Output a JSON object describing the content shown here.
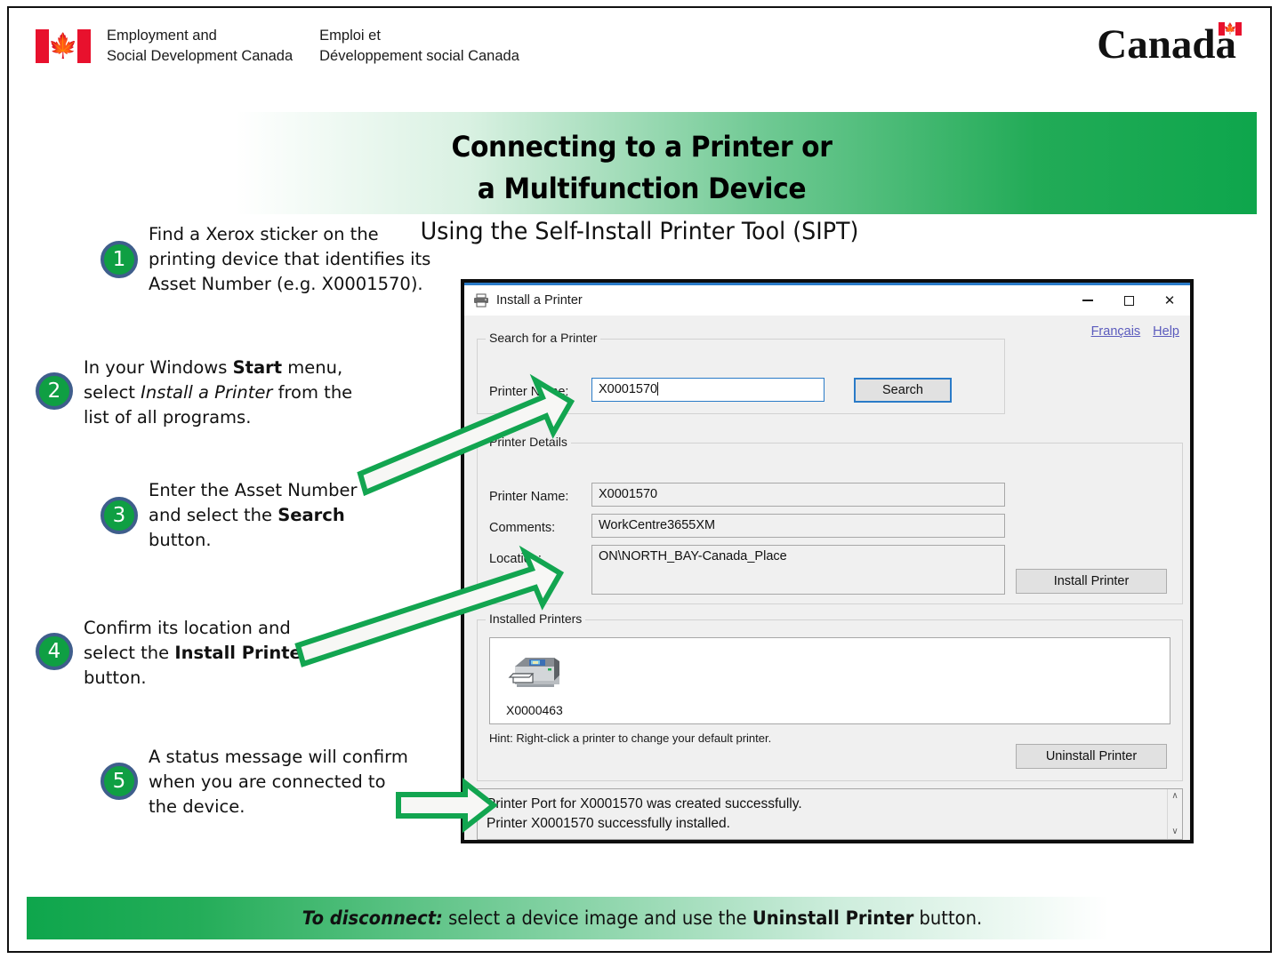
{
  "masthead": {
    "dept_en_line1": "Employment and",
    "dept_en_line2": "Social Development Canada",
    "dept_fr_line1": "Emploi et",
    "dept_fr_line2": "Développement social Canada",
    "wordmark": "Canada",
    "flag_icon": "canada-flag-icon",
    "leaf_glyph": "🍁"
  },
  "banner": {
    "title_line1": "Connecting to a Printer or",
    "title_line2": "a Multifunction Device",
    "subtitle": "Using the Self-Install Printer Tool (SIPT)",
    "gradient_start": "#ffffff",
    "gradient_end": "#0ea64c"
  },
  "steps": [
    {
      "number": "1",
      "lines": [
        {
          "t": "Find a Xerox sticker on the"
        },
        {
          "t": "printing device that identifies its"
        },
        {
          "t": "Asset Number (e.g. X0001570)."
        }
      ]
    },
    {
      "number": "2",
      "lines": [
        {
          "t": "In your Windows "
        },
        {
          "t": "Start",
          "style": "bold"
        },
        {
          "t": " menu,"
        }
      ]
    },
    {
      "number": "3",
      "lines": []
    },
    {
      "number": "4",
      "lines": []
    },
    {
      "number": "5",
      "lines": []
    }
  ],
  "step_text": {
    "s1": "Find a Xerox sticker on the printing device that identifies its Asset Number (e.g. X0001570).",
    "s2_a": "In your Windows ",
    "s2_b": "Start",
    "s2_c": " menu,",
    "s2_d": "select ",
    "s2_e": "Install a Printer",
    "s2_f": " from the",
    "s2_g": "list of all programs.",
    "s3_a": "Enter the Asset Number",
    "s3_b": "and select the ",
    "s3_c": "Search",
    "s3_d": "button.",
    "s4_a": "Confirm its location and",
    "s4_b": "select the ",
    "s4_c": "Install Printer",
    "s4_d": "button.",
    "s5_a": "A status message will confirm",
    "s5_b": "when you are connected to",
    "s5_c": "the device."
  },
  "dialog": {
    "title": "Install a Printer",
    "title_icon": "printer-icon",
    "minimize_label": "Minimize",
    "maximize_label": "Maximize",
    "close_label": "✕",
    "links": {
      "francais": "Français",
      "help": "Help"
    },
    "search_group": {
      "label": "Search for a Printer",
      "printer_name_label": "Printer Name:",
      "printer_name_value": "X0001570",
      "search_button": "Search"
    },
    "details_group": {
      "label": "Printer Details",
      "printer_name_label": "Printer Name:",
      "printer_name_value": "X0001570",
      "comments_label": "Comments:",
      "comments_value": "WorkCentre3655XM",
      "location_label": "Location:",
      "location_value": "ON\\NORTH_BAY-Canada_Place",
      "install_button": "Install Printer"
    },
    "installed_group": {
      "label": "Installed Printers",
      "printers": [
        {
          "name": "X0000463",
          "icon": "multifunction-printer-icon"
        }
      ],
      "hint": "Hint: Right-click a printer to change your default printer.",
      "uninstall_button": "Uninstall Printer"
    },
    "status": {
      "line1": "Printer Port for X0001570 was created successfully.",
      "line2": "Printer X0001570 successfully installed.",
      "scroll_up": "∧",
      "scroll_down": "∨"
    }
  },
  "footer": {
    "lead": "To disconnect:",
    "mid": " select a device image and use the ",
    "bold": "Uninstall Printer",
    "tail": " button.",
    "gradient_start": "#0ea64c",
    "gradient_end": "#ffffff"
  },
  "colors": {
    "green": "#0ea64c",
    "badge_green": "#0f9f43",
    "badge_ring": "#3f5e8c",
    "arrow_green": "#12a550",
    "link": "#5b5bbd",
    "accent_blue": "#2a7bc8",
    "flag_red": "#e8112d"
  }
}
